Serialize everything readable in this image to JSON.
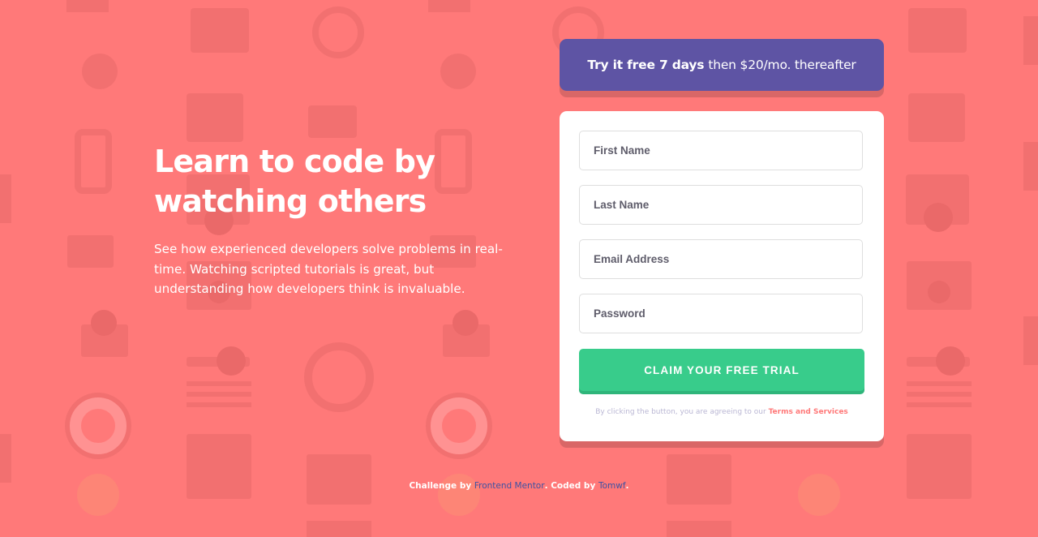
{
  "colors": {
    "background": "#ff7979",
    "banner": "#5e54a4",
    "button": "#38cc8b",
    "accent": "#ff7979",
    "link": "#3e52a3"
  },
  "hero": {
    "title_line1": "Learn to code by",
    "title_line2": "watching others",
    "description": "See how experienced developers solve problems in real-time. Watching scripted tutorials is great, but understanding how developers think is invaluable."
  },
  "banner": {
    "bold": "Try it free 7 days",
    "rest": "then $20/mo. thereafter"
  },
  "form": {
    "first_name_placeholder": "First Name",
    "last_name_placeholder": "Last Name",
    "email_placeholder": "Email Address",
    "password_placeholder": "Password",
    "submit_label": "CLAIM YOUR FREE TRIAL",
    "terms_text": "By clicking the button, you are agreeing to our",
    "terms_link": "Terms and Services"
  },
  "footer": {
    "challenge_by": "Challenge by",
    "frontend_mentor": "Frontend Mentor",
    "coded_by": ". Coded by",
    "author": "Tomwf",
    "end": "."
  },
  "background_icons": [
    "gear-icon",
    "headset-icon",
    "network-icon",
    "toolbox-icon",
    "chart-icon",
    "cart-icon",
    "lifebuoy-icon",
    "calendar-icon",
    "house-icon",
    "lightbulb-icon",
    "key-icon",
    "magnifier-icon"
  ]
}
